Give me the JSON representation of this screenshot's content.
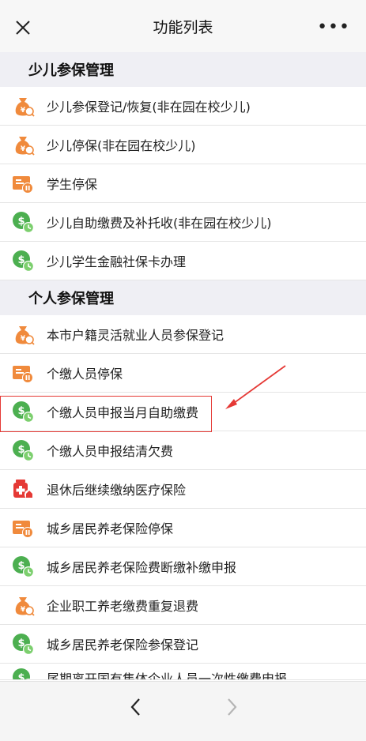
{
  "header": {
    "title": "功能列表",
    "more_label": "•••"
  },
  "sections": [
    {
      "title": "少儿参保管理",
      "items": [
        {
          "label": "少儿参保登记/恢复(非在园在校少儿)",
          "icon": "money-bag-icon"
        },
        {
          "label": "少儿停保(非在园在校少儿)",
          "icon": "money-bag-icon"
        },
        {
          "label": "学生停保",
          "icon": "pause-card-icon"
        },
        {
          "label": "少儿自助缴费及补托收(非在园在校少儿)",
          "icon": "payment-clock-icon"
        },
        {
          "label": "少儿学生金融社保卡办理",
          "icon": "payment-clock-icon"
        }
      ]
    },
    {
      "title": "个人参保管理",
      "items": [
        {
          "label": "本市户籍灵活就业人员参保登记",
          "icon": "money-bag-icon"
        },
        {
          "label": "个缴人员停保",
          "icon": "pause-card-icon"
        },
        {
          "label": "个缴人员申报当月自助缴费",
          "icon": "payment-clock-icon"
        },
        {
          "label": "个缴人员申报结清欠费",
          "icon": "payment-clock-icon"
        },
        {
          "label": "退休后继续缴纳医疗保险",
          "icon": "medical-kit-icon"
        },
        {
          "label": "城乡居民养老保险停保",
          "icon": "pause-card-icon"
        },
        {
          "label": "城乡居民养老保险费断缴补缴申报",
          "icon": "payment-clock-icon"
        },
        {
          "label": "企业职工养老缴费重复退费",
          "icon": "money-bag-icon"
        },
        {
          "label": "城乡居民养老保险参保登记",
          "icon": "payment-clock-icon"
        },
        {
          "label": "尾期离开国有集体企业人员一次性缴费申报",
          "icon": "payment-clock-icon"
        }
      ]
    }
  ],
  "colors": {
    "orange": "#f08a3c",
    "green": "#4caf50",
    "red": "#e53935",
    "section_bg": "#efeff4"
  }
}
